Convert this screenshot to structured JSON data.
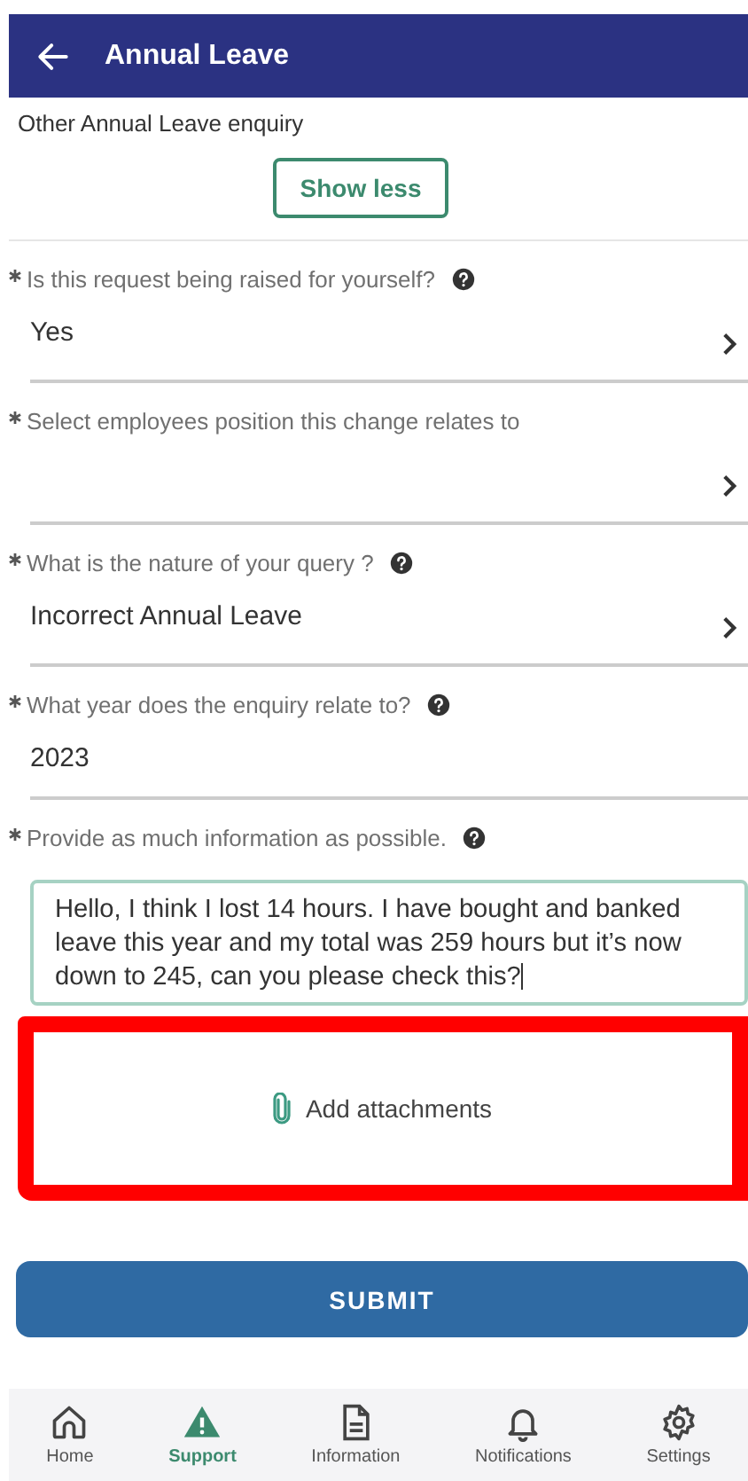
{
  "header": {
    "title": "Annual Leave"
  },
  "subtitle": "Other Annual Leave enquiry",
  "toggle_button": "Show less",
  "fields": [
    {
      "kind": "select",
      "label": "Is this request being raised for yourself?",
      "help": true,
      "value": "Yes"
    },
    {
      "kind": "select",
      "label": "Select employees position this change relates to",
      "help": false
    },
    {
      "kind": "select",
      "label": "What is the nature of your query ?",
      "help": true,
      "value": "Incorrect Annual Leave"
    },
    {
      "kind": "text",
      "label": "What year does the enquiry relate to?",
      "help": true,
      "value": "2023"
    },
    {
      "kind": "textarea",
      "label": "Provide as much information as possible.",
      "help": true,
      "value": "Hello, I think I lost 14 hours. I have bought and banked leave this year and my total was 259 hours but it’s now down to 245, can you please check this?"
    }
  ],
  "attachments": {
    "label": "Add attachments",
    "highlighted": true
  },
  "submit": "SUBMIT",
  "nav": [
    {
      "label": "Home",
      "selected": false
    },
    {
      "label": "Support",
      "selected": true
    },
    {
      "label": "Information",
      "selected": false
    },
    {
      "label": "Notifications",
      "selected": false
    },
    {
      "label": "Settings",
      "selected": false
    }
  ]
}
